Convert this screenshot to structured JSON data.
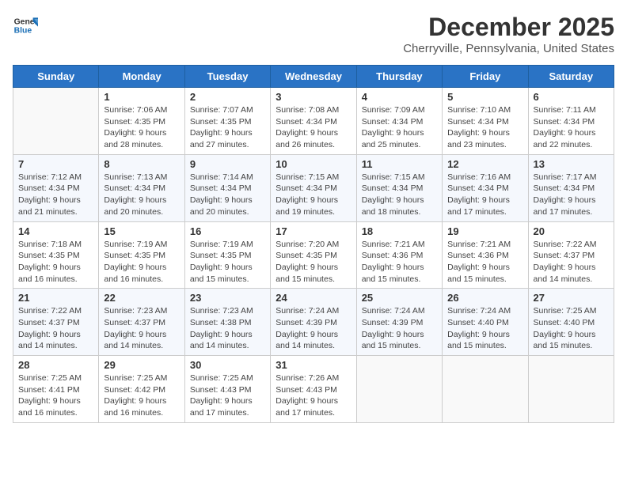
{
  "header": {
    "logo_line1": "General",
    "logo_line2": "Blue",
    "month_title": "December 2025",
    "location": "Cherryville, Pennsylvania, United States"
  },
  "weekdays": [
    "Sunday",
    "Monday",
    "Tuesday",
    "Wednesday",
    "Thursday",
    "Friday",
    "Saturday"
  ],
  "weeks": [
    [
      {
        "day": "",
        "sunrise": "",
        "sunset": "",
        "daylight": ""
      },
      {
        "day": "1",
        "sunrise": "Sunrise: 7:06 AM",
        "sunset": "Sunset: 4:35 PM",
        "daylight": "Daylight: 9 hours and 28 minutes."
      },
      {
        "day": "2",
        "sunrise": "Sunrise: 7:07 AM",
        "sunset": "Sunset: 4:35 PM",
        "daylight": "Daylight: 9 hours and 27 minutes."
      },
      {
        "day": "3",
        "sunrise": "Sunrise: 7:08 AM",
        "sunset": "Sunset: 4:34 PM",
        "daylight": "Daylight: 9 hours and 26 minutes."
      },
      {
        "day": "4",
        "sunrise": "Sunrise: 7:09 AM",
        "sunset": "Sunset: 4:34 PM",
        "daylight": "Daylight: 9 hours and 25 minutes."
      },
      {
        "day": "5",
        "sunrise": "Sunrise: 7:10 AM",
        "sunset": "Sunset: 4:34 PM",
        "daylight": "Daylight: 9 hours and 23 minutes."
      },
      {
        "day": "6",
        "sunrise": "Sunrise: 7:11 AM",
        "sunset": "Sunset: 4:34 PM",
        "daylight": "Daylight: 9 hours and 22 minutes."
      }
    ],
    [
      {
        "day": "7",
        "sunrise": "Sunrise: 7:12 AM",
        "sunset": "Sunset: 4:34 PM",
        "daylight": "Daylight: 9 hours and 21 minutes."
      },
      {
        "day": "8",
        "sunrise": "Sunrise: 7:13 AM",
        "sunset": "Sunset: 4:34 PM",
        "daylight": "Daylight: 9 hours and 20 minutes."
      },
      {
        "day": "9",
        "sunrise": "Sunrise: 7:14 AM",
        "sunset": "Sunset: 4:34 PM",
        "daylight": "Daylight: 9 hours and 20 minutes."
      },
      {
        "day": "10",
        "sunrise": "Sunrise: 7:15 AM",
        "sunset": "Sunset: 4:34 PM",
        "daylight": "Daylight: 9 hours and 19 minutes."
      },
      {
        "day": "11",
        "sunrise": "Sunrise: 7:15 AM",
        "sunset": "Sunset: 4:34 PM",
        "daylight": "Daylight: 9 hours and 18 minutes."
      },
      {
        "day": "12",
        "sunrise": "Sunrise: 7:16 AM",
        "sunset": "Sunset: 4:34 PM",
        "daylight": "Daylight: 9 hours and 17 minutes."
      },
      {
        "day": "13",
        "sunrise": "Sunrise: 7:17 AM",
        "sunset": "Sunset: 4:34 PM",
        "daylight": "Daylight: 9 hours and 17 minutes."
      }
    ],
    [
      {
        "day": "14",
        "sunrise": "Sunrise: 7:18 AM",
        "sunset": "Sunset: 4:35 PM",
        "daylight": "Daylight: 9 hours and 16 minutes."
      },
      {
        "day": "15",
        "sunrise": "Sunrise: 7:19 AM",
        "sunset": "Sunset: 4:35 PM",
        "daylight": "Daylight: 9 hours and 16 minutes."
      },
      {
        "day": "16",
        "sunrise": "Sunrise: 7:19 AM",
        "sunset": "Sunset: 4:35 PM",
        "daylight": "Daylight: 9 hours and 15 minutes."
      },
      {
        "day": "17",
        "sunrise": "Sunrise: 7:20 AM",
        "sunset": "Sunset: 4:35 PM",
        "daylight": "Daylight: 9 hours and 15 minutes."
      },
      {
        "day": "18",
        "sunrise": "Sunrise: 7:21 AM",
        "sunset": "Sunset: 4:36 PM",
        "daylight": "Daylight: 9 hours and 15 minutes."
      },
      {
        "day": "19",
        "sunrise": "Sunrise: 7:21 AM",
        "sunset": "Sunset: 4:36 PM",
        "daylight": "Daylight: 9 hours and 15 minutes."
      },
      {
        "day": "20",
        "sunrise": "Sunrise: 7:22 AM",
        "sunset": "Sunset: 4:37 PM",
        "daylight": "Daylight: 9 hours and 14 minutes."
      }
    ],
    [
      {
        "day": "21",
        "sunrise": "Sunrise: 7:22 AM",
        "sunset": "Sunset: 4:37 PM",
        "daylight": "Daylight: 9 hours and 14 minutes."
      },
      {
        "day": "22",
        "sunrise": "Sunrise: 7:23 AM",
        "sunset": "Sunset: 4:37 PM",
        "daylight": "Daylight: 9 hours and 14 minutes."
      },
      {
        "day": "23",
        "sunrise": "Sunrise: 7:23 AM",
        "sunset": "Sunset: 4:38 PM",
        "daylight": "Daylight: 9 hours and 14 minutes."
      },
      {
        "day": "24",
        "sunrise": "Sunrise: 7:24 AM",
        "sunset": "Sunset: 4:39 PM",
        "daylight": "Daylight: 9 hours and 14 minutes."
      },
      {
        "day": "25",
        "sunrise": "Sunrise: 7:24 AM",
        "sunset": "Sunset: 4:39 PM",
        "daylight": "Daylight: 9 hours and 15 minutes."
      },
      {
        "day": "26",
        "sunrise": "Sunrise: 7:24 AM",
        "sunset": "Sunset: 4:40 PM",
        "daylight": "Daylight: 9 hours and 15 minutes."
      },
      {
        "day": "27",
        "sunrise": "Sunrise: 7:25 AM",
        "sunset": "Sunset: 4:40 PM",
        "daylight": "Daylight: 9 hours and 15 minutes."
      }
    ],
    [
      {
        "day": "28",
        "sunrise": "Sunrise: 7:25 AM",
        "sunset": "Sunset: 4:41 PM",
        "daylight": "Daylight: 9 hours and 16 minutes."
      },
      {
        "day": "29",
        "sunrise": "Sunrise: 7:25 AM",
        "sunset": "Sunset: 4:42 PM",
        "daylight": "Daylight: 9 hours and 16 minutes."
      },
      {
        "day": "30",
        "sunrise": "Sunrise: 7:25 AM",
        "sunset": "Sunset: 4:43 PM",
        "daylight": "Daylight: 9 hours and 17 minutes."
      },
      {
        "day": "31",
        "sunrise": "Sunrise: 7:26 AM",
        "sunset": "Sunset: 4:43 PM",
        "daylight": "Daylight: 9 hours and 17 minutes."
      },
      {
        "day": "",
        "sunrise": "",
        "sunset": "",
        "daylight": ""
      },
      {
        "day": "",
        "sunrise": "",
        "sunset": "",
        "daylight": ""
      },
      {
        "day": "",
        "sunrise": "",
        "sunset": "",
        "daylight": ""
      }
    ]
  ]
}
